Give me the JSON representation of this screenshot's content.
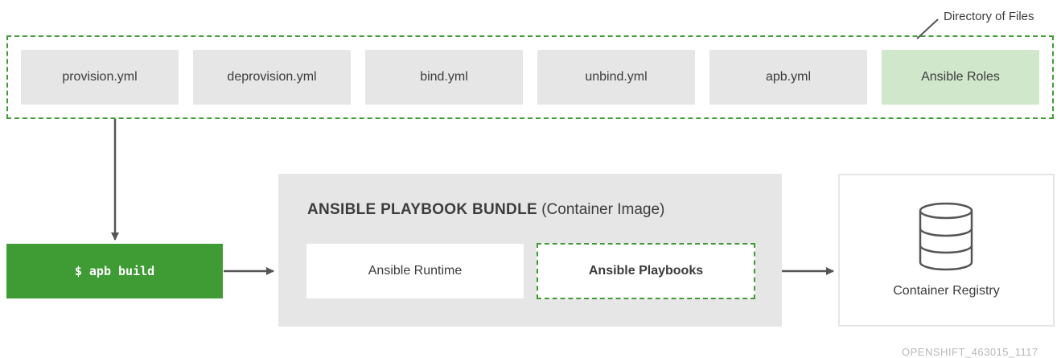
{
  "directory": {
    "label": "Directory of Files",
    "files": [
      "provision.yml",
      "deprovision.yml",
      "bind.yml",
      "unbind.yml",
      "apb.yml",
      "Ansible Roles"
    ]
  },
  "build": {
    "command": "$ apb build"
  },
  "bundle": {
    "title_strong": "ANSIBLE PLAYBOOK BUNDLE",
    "title_rest": " (Container Image)",
    "runtime": "Ansible Runtime",
    "playbooks": "Ansible Playbooks"
  },
  "registry": {
    "label": "Container Registry",
    "icon": "database-icon"
  },
  "footer": {
    "id": "OPENSHIFT_463015_1117"
  },
  "colors": {
    "green": "#3f9c35",
    "light_green": "#d0e7cb",
    "gray": "#e6e6e6",
    "arrow": "#555555"
  }
}
